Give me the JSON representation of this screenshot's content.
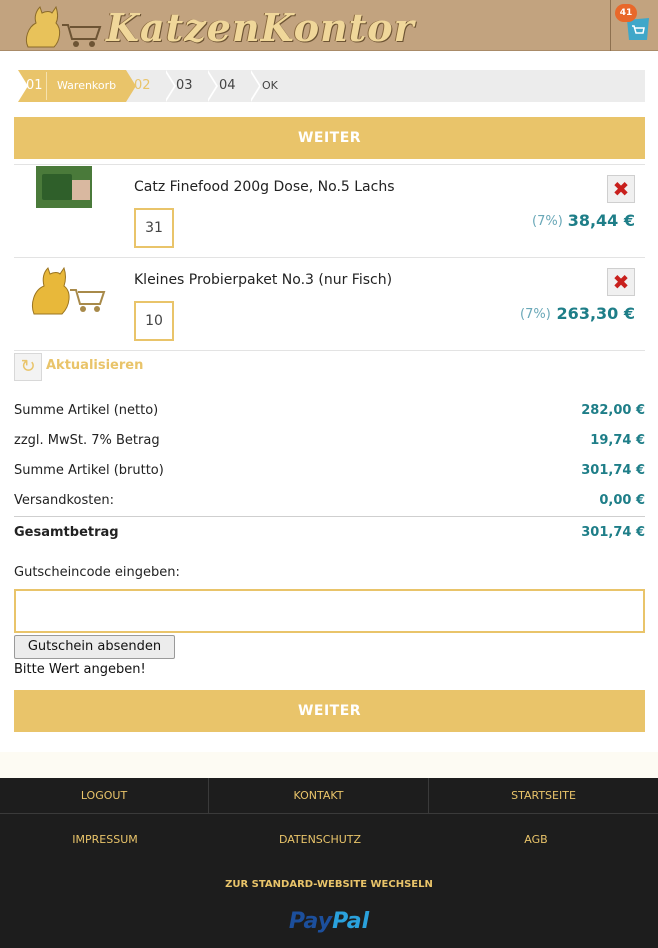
{
  "header": {
    "logo_text": "KatzenKontor",
    "cart_count": "41"
  },
  "steps": {
    "s1_num": "01",
    "s1_label": "Warenkorb",
    "s2": "02",
    "s3": "03",
    "s4": "04",
    "s5": "OK"
  },
  "buttons": {
    "weiter_top": "WEITER",
    "weiter_bottom": "WEITER"
  },
  "items": [
    {
      "name": "Catz Finefood 200g Dose, No.5 Lachs",
      "qty": "31",
      "vat": "(7%)",
      "price": "38,44 €",
      "delete": "✖"
    },
    {
      "name": "Kleines Probierpaket No.3 (nur Fisch)",
      "qty": "10",
      "vat": "(7%)",
      "price": "263,30 €",
      "delete": "✖"
    }
  ],
  "update_label": "Aktualisieren",
  "summary": {
    "netto_label": "Summe Artikel (netto)",
    "netto_value": "282,00 €",
    "mwst_label": "zzgl. MwSt. 7% Betrag",
    "mwst_value": "19,74 €",
    "brutto_label": "Summe Artikel (brutto)",
    "brutto_value": "301,74 €",
    "versand_label": "Versandkosten:",
    "versand_value": "0,00 €",
    "gesamt_label": "Gesamtbetrag",
    "gesamt_value": "301,74 €"
  },
  "coupon": {
    "label": "Gutscheincode eingeben:",
    "value": "",
    "button": "Gutschein absenden",
    "hint": "Bitte Wert angeben!"
  },
  "footer": {
    "logout": "LOGOUT",
    "kontakt": "KONTAKT",
    "startseite": "STARTSEITE",
    "impressum": "IMPRESSUM",
    "datenschutz": "DATENSCHUTZ",
    "agb": "AGB",
    "switch": "ZUR STANDARD-WEBSITE WECHSELN",
    "paypal_a": "Pay",
    "paypal_b": "Pal"
  },
  "colors": {
    "accent": "#e9c46a",
    "header_bg": "#c2a37f",
    "price": "#1e7e88",
    "footer_bg": "#1d1d1d"
  },
  "icons": {
    "logo": "cat-with-cart-icon",
    "cart": "shopping-cart-icon",
    "delete": "close-icon",
    "refresh": "refresh-icon"
  }
}
